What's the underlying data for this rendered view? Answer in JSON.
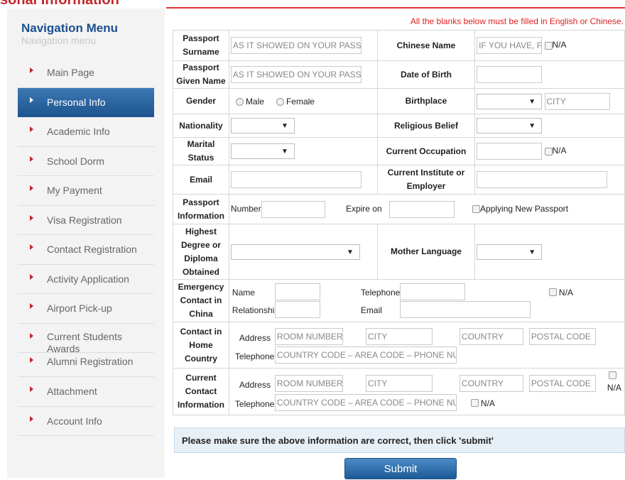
{
  "page_title": "sonal Information",
  "notice": "All the blanks below must be filled in English or Chinese.",
  "sidebar": {
    "title": "Navigation Menu",
    "subtitle": "Navigation menu",
    "items": [
      {
        "label": "Main Page"
      },
      {
        "label": "Personal Info",
        "active": true
      },
      {
        "label": "Academic Info"
      },
      {
        "label": "School Dorm"
      },
      {
        "label": "My Payment"
      },
      {
        "label": "Visa Registration"
      },
      {
        "label": "Contact Registration"
      },
      {
        "label": "Activity Application"
      },
      {
        "label": "Airport Pick-up"
      },
      {
        "label": "Current Students Awards"
      },
      {
        "label": "Alumni Registration"
      },
      {
        "label": "Attachment"
      },
      {
        "label": "Account Info"
      }
    ]
  },
  "form": {
    "passport_surname": {
      "label": "Passport Surname",
      "placeholder": "AS IT SHOWED ON YOUR PASSPORT"
    },
    "chinese_name": {
      "label": "Chinese Name",
      "placeholder": "IF YOU HAVE, PLEASE FILL",
      "na": "N/A"
    },
    "passport_given": {
      "label": "Passport Given Name",
      "placeholder": "AS IT SHOWED ON YOUR PASSPORT"
    },
    "dob": {
      "label": "Date of Birth"
    },
    "gender": {
      "label": "Gender",
      "male": "Male",
      "female": "Female"
    },
    "birthplace": {
      "label": "Birthplace",
      "city_placeholder": "CITY"
    },
    "nationality": {
      "label": "Nationality"
    },
    "religious": {
      "label": "Religious Belief"
    },
    "marital": {
      "label": "Marital Status"
    },
    "occupation": {
      "label": "Current Occupation",
      "na": "N/A"
    },
    "email": {
      "label": "Email"
    },
    "institute": {
      "label": "Current Institute or Employer"
    },
    "passport_info": {
      "label": "Passport Information",
      "number": "Number",
      "expire": "Expire on",
      "new_passport": "Applying New Passport"
    },
    "degree": {
      "label": "Highest Degree or Diploma Obtained"
    },
    "mother_lang": {
      "label": "Mother Language"
    },
    "emergency": {
      "label": "Emergency Contact in China",
      "name": "Name",
      "telephone": "Telephone",
      "relationship": "Relationship",
      "email": "Email",
      "na": "N/A"
    },
    "home_contact": {
      "label": "Contact in Home Country",
      "address": "Address",
      "room_ph": "ROOM NUMBER & STREET",
      "city_ph": "CITY",
      "country_ph": "COUNTRY",
      "postal_ph": "POSTAL CODE",
      "telephone": "Telephone",
      "phone_ph": "COUNTRY CODE – AREA CODE – PHONE NUMBER"
    },
    "current_contact": {
      "label": "Current Contact Information",
      "address": "Address",
      "room_ph": "ROOM NUMBER & STREET",
      "city_ph": "CITY",
      "country_ph": "COUNTRY",
      "postal_ph": "POSTAL CODE",
      "telephone": "Telephone",
      "phone_ph": "COUNTRY CODE – AREA CODE – PHONE NUMBER",
      "na": "N/A"
    }
  },
  "confirm_note": "Please make sure the above information are correct, then click 'submit'",
  "submit_label": "Submit"
}
